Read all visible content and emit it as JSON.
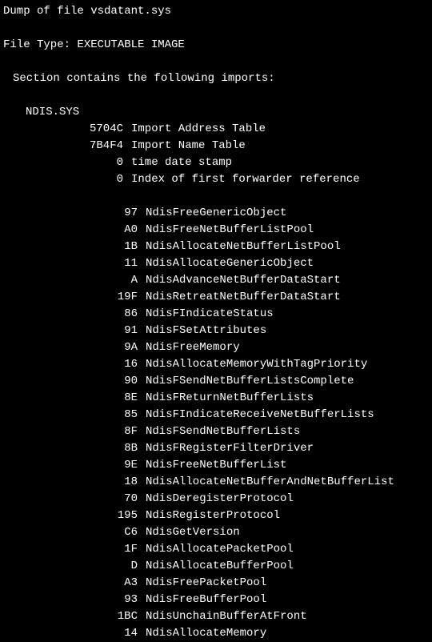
{
  "dump_line": "Dump of file vsdatant.sys",
  "file_type_line": "File Type: EXECUTABLE IMAGE",
  "section_line": "Section contains the following imports:",
  "module_name": "NDIS.SYS",
  "headers": [
    {
      "addr": "5704C",
      "label": "Import Address Table"
    },
    {
      "addr": "7B4F4",
      "label": "Import Name Table"
    },
    {
      "addr": "0",
      "label": "time date stamp"
    },
    {
      "addr": "0",
      "label": "Index of first forwarder reference"
    }
  ],
  "imports": [
    {
      "ordinal": "97",
      "name": "NdisFreeGenericObject"
    },
    {
      "ordinal": "A0",
      "name": "NdisFreeNetBufferListPool"
    },
    {
      "ordinal": "1B",
      "name": "NdisAllocateNetBufferListPool"
    },
    {
      "ordinal": "11",
      "name": "NdisAllocateGenericObject"
    },
    {
      "ordinal": "A",
      "name": "NdisAdvanceNetBufferDataStart"
    },
    {
      "ordinal": "19F",
      "name": "NdisRetreatNetBufferDataStart"
    },
    {
      "ordinal": "86",
      "name": "NdisFIndicateStatus"
    },
    {
      "ordinal": "91",
      "name": "NdisFSetAttributes"
    },
    {
      "ordinal": "9A",
      "name": "NdisFreeMemory"
    },
    {
      "ordinal": "16",
      "name": "NdisAllocateMemoryWithTagPriority"
    },
    {
      "ordinal": "90",
      "name": "NdisFSendNetBufferListsComplete"
    },
    {
      "ordinal": "8E",
      "name": "NdisFReturnNetBufferLists"
    },
    {
      "ordinal": "85",
      "name": "NdisFIndicateReceiveNetBufferLists"
    },
    {
      "ordinal": "8F",
      "name": "NdisFSendNetBufferLists"
    },
    {
      "ordinal": "8B",
      "name": "NdisFRegisterFilterDriver"
    },
    {
      "ordinal": "9E",
      "name": "NdisFreeNetBufferList"
    },
    {
      "ordinal": "18",
      "name": "NdisAllocateNetBufferAndNetBufferList"
    },
    {
      "ordinal": "70",
      "name": "NdisDeregisterProtocol"
    },
    {
      "ordinal": "195",
      "name": "NdisRegisterProtocol"
    },
    {
      "ordinal": "C6",
      "name": "NdisGetVersion"
    },
    {
      "ordinal": "1F",
      "name": "NdisAllocatePacketPool"
    },
    {
      "ordinal": "D",
      "name": "NdisAllocateBufferPool"
    },
    {
      "ordinal": "A3",
      "name": "NdisFreePacketPool"
    },
    {
      "ordinal": "93",
      "name": "NdisFreeBufferPool"
    },
    {
      "ordinal": "1BC",
      "name": "NdisUnchainBufferAtFront"
    },
    {
      "ordinal": "14",
      "name": "NdisAllocateMemory"
    }
  ]
}
